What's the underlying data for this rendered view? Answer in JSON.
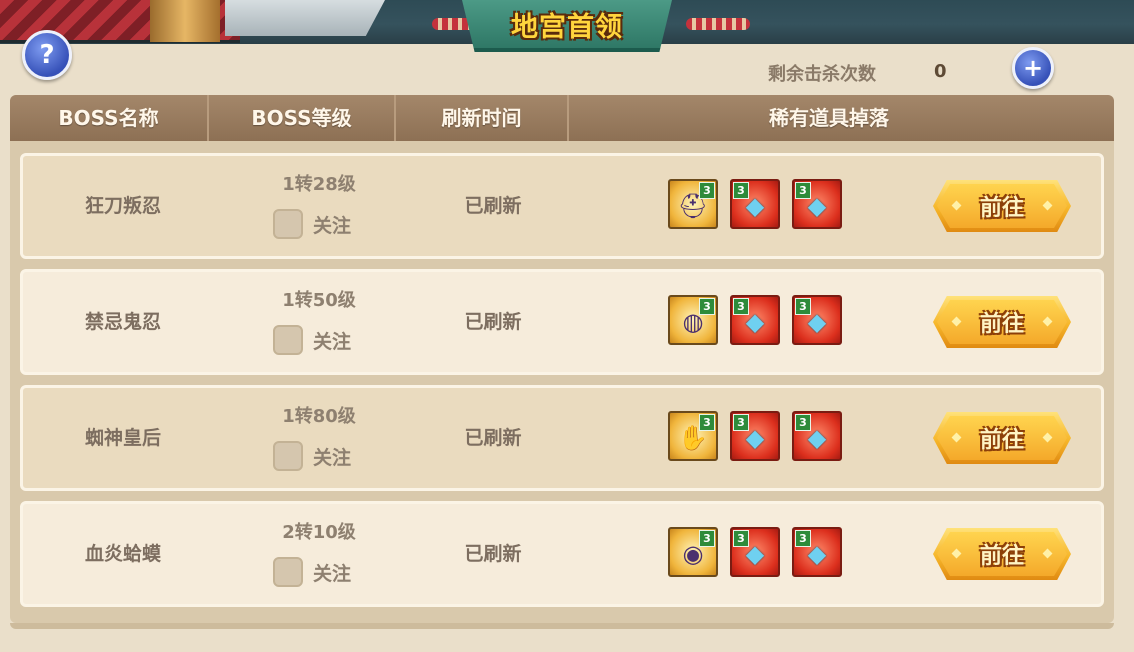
{
  "header": {
    "title": "地宫首领",
    "help_icon": "?",
    "kills_label": "剩余击杀次数",
    "kills_value": "0",
    "add_icon": "+"
  },
  "columns": [
    "BOSS名称",
    "BOSS等级",
    "刷新时间",
    "稀有道具掉落"
  ],
  "follow_label": "关注",
  "go_label": "前往",
  "rows": [
    {
      "name": "狂刀叛忍",
      "level": "1转28级",
      "refresh": "已刷新",
      "items": [
        {
          "icon": "helmet-icon",
          "glyph": "⛑",
          "badge": "3"
        },
        {
          "icon": "crystal-icon",
          "glyph": "◆",
          "badge": "3"
        },
        {
          "icon": "crystal-icon",
          "glyph": "◆",
          "badge": "3"
        }
      ]
    },
    {
      "name": "禁忌鬼忍",
      "level": "1转50级",
      "refresh": "已刷新",
      "items": [
        {
          "icon": "ring-icon",
          "glyph": "◍",
          "badge": "3"
        },
        {
          "icon": "crystal-icon",
          "glyph": "◆",
          "badge": "3"
        },
        {
          "icon": "crystal-icon",
          "glyph": "◆",
          "badge": "3"
        }
      ]
    },
    {
      "name": "蜘神皇后",
      "level": "1转80级",
      "refresh": "已刷新",
      "items": [
        {
          "icon": "glove-icon",
          "glyph": "✋",
          "badge": "3"
        },
        {
          "icon": "crystal-icon",
          "glyph": "◆",
          "badge": "3"
        },
        {
          "icon": "crystal-icon",
          "glyph": "◆",
          "badge": "3"
        }
      ]
    },
    {
      "name": "血炎蛤蟆",
      "level": "2转10级",
      "refresh": "已刷新",
      "items": [
        {
          "icon": "amulet-icon",
          "glyph": "◉",
          "badge": "3"
        },
        {
          "icon": "crystal-icon",
          "glyph": "◆",
          "badge": "3"
        },
        {
          "icon": "crystal-icon",
          "glyph": "◆",
          "badge": "3"
        }
      ]
    }
  ]
}
